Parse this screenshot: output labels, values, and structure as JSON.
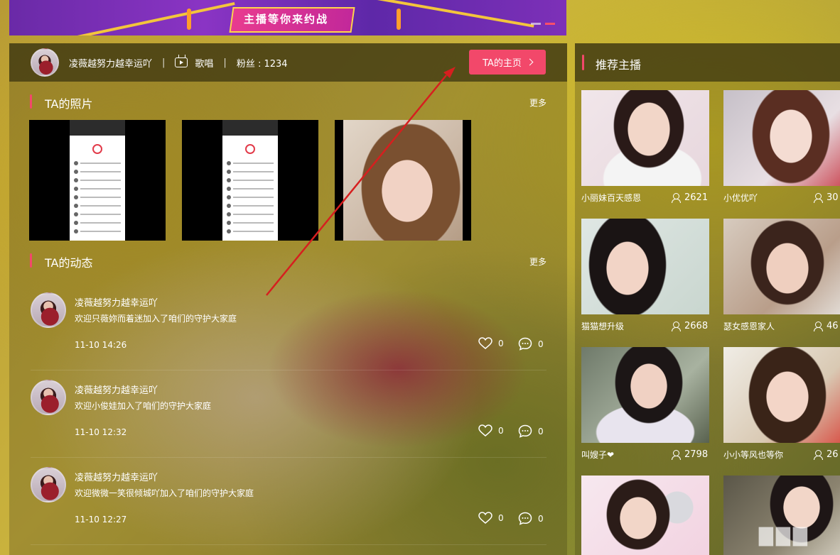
{
  "banner": {
    "slogan": "主播等你来约战"
  },
  "profile": {
    "name": "凌薇越努力越幸运吖",
    "category": "歌唱",
    "fans_label": "粉丝 : 1234",
    "separator": "|",
    "homepage_button": "TA的主页"
  },
  "photos": {
    "title": "TA的照片",
    "more": "更多"
  },
  "feed": {
    "title": "TA的动态",
    "more": "更多",
    "items": [
      {
        "name": "凌薇越努力越幸运吖",
        "message": "欢迎只薇妳而着迷加入了咱们的守护大家庭",
        "time": "11-10 14:26",
        "likes": "0",
        "comments": "0"
      },
      {
        "name": "凌薇越努力越幸运吖",
        "message": "欢迎小俊娃加入了咱们的守护大家庭",
        "time": "11-10 12:32",
        "likes": "0",
        "comments": "0"
      },
      {
        "name": "凌薇越努力越幸运吖",
        "message": "欢迎微微一笑很倾城吖加入了咱们的守护大家庭",
        "time": "11-10 12:27",
        "likes": "0",
        "comments": "0"
      }
    ]
  },
  "recommend": {
    "title": "推荐主播",
    "anchors": [
      {
        "name": "小丽妹百天感恩",
        "fans": "2621"
      },
      {
        "name": "小优优吖",
        "fans": "30"
      },
      {
        "name": "猫猫想升级",
        "fans": "2668"
      },
      {
        "name": "瑟女感恩家人",
        "fans": "46"
      },
      {
        "name": "叫嫂子❤",
        "fans": "2798"
      },
      {
        "name": "小小等风也等你",
        "fans": "26"
      },
      {
        "name": "",
        "fans": ""
      },
      {
        "name": "",
        "fans": ""
      }
    ]
  },
  "colors": {
    "accent": "#f2486a",
    "annotation_arrow": "#d61f1f"
  }
}
